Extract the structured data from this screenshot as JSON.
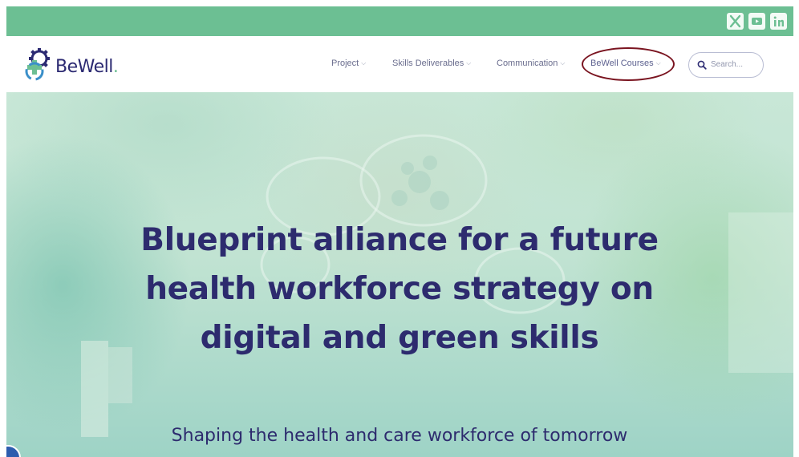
{
  "brand": {
    "name": "BeWell",
    "dot": ".",
    "logo_icon": "gear-cross-icon",
    "colors": {
      "primary": "#2c2a72",
      "accent": "#6cbf93",
      "annotation": "#7a1420"
    }
  },
  "social": [
    {
      "name": "x-icon",
      "glyph": "X"
    },
    {
      "name": "youtube-icon",
      "glyph": "▶"
    },
    {
      "name": "linkedin-icon",
      "glyph": "in"
    }
  ],
  "nav": {
    "items": [
      {
        "label": "Project"
      },
      {
        "label": "Skills Deliverables"
      },
      {
        "label": "Communication"
      },
      {
        "label": "BeWell Courses"
      }
    ],
    "chevron": "⌵"
  },
  "search": {
    "placeholder": "Search..."
  },
  "hero": {
    "headline": [
      "Blueprint alliance for a future",
      "health workforce strategy on",
      "digital and green skills"
    ],
    "subline": "Shaping the health and care workforce of tomorrow"
  }
}
